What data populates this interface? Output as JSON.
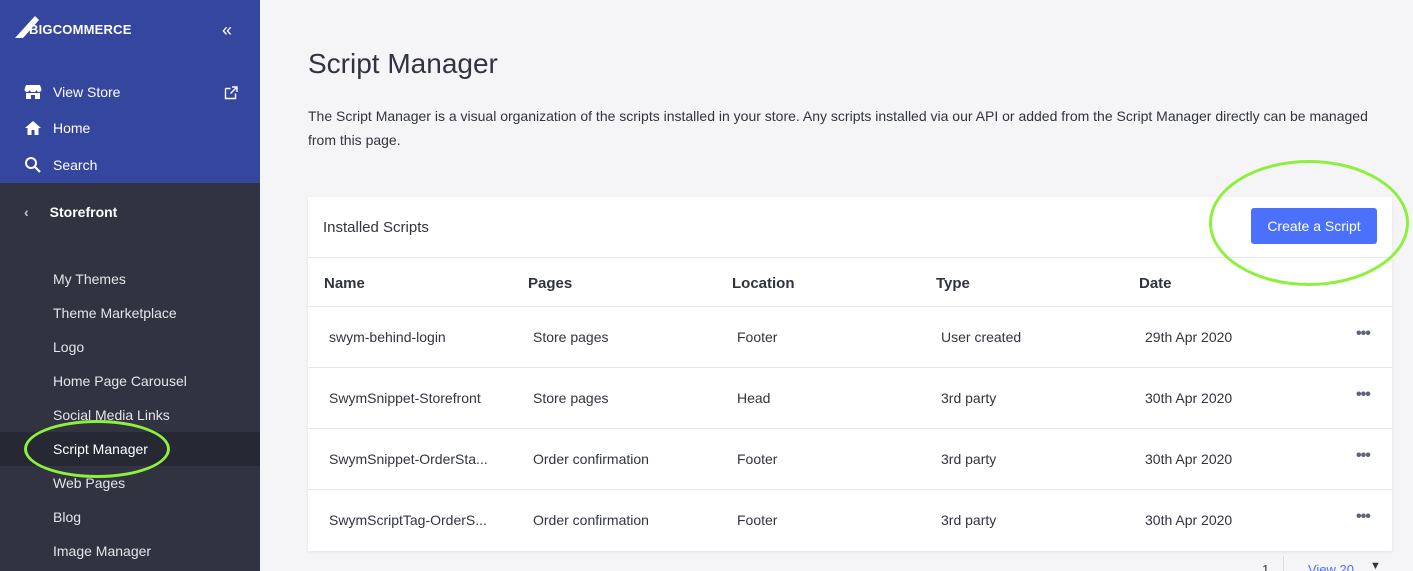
{
  "brand": {
    "logo_text": "BIGCOMMERCE",
    "collapse_glyph": "«"
  },
  "colors": {
    "sidebar_top": "#34469e",
    "sidebar": "#313440",
    "active_item": "#262833",
    "primary_button": "#4b71fc",
    "highlight_circle": "#8cf03c"
  },
  "top_nav": [
    {
      "label": "View Store",
      "icon": "store-icon"
    },
    {
      "label": "Home",
      "icon": "home-icon"
    },
    {
      "label": "Search",
      "icon": "search-icon"
    }
  ],
  "section": {
    "label": "Storefront",
    "chevron": "‹"
  },
  "sub_nav": [
    {
      "label": "My Themes"
    },
    {
      "label": "Theme Marketplace"
    },
    {
      "label": "Logo"
    },
    {
      "label": "Home Page Carousel"
    },
    {
      "label": "Social Media Links"
    },
    {
      "label": "Script Manager",
      "active": true
    },
    {
      "label": "Web Pages"
    },
    {
      "label": "Blog"
    },
    {
      "label": "Image Manager"
    }
  ],
  "page": {
    "title": "Script Manager",
    "description": "The Script Manager is a visual organization of the scripts installed in your store. Any scripts installed via our API or added from the Script Manager directly can be managed from this page."
  },
  "panel": {
    "title": "Installed Scripts",
    "create_button": "Create a Script",
    "columns": [
      "Name",
      "Pages",
      "Location",
      "Type",
      "Date"
    ],
    "rows": [
      {
        "name": "swym-behind-login",
        "pages": "Store pages",
        "location": "Footer",
        "type": "User created",
        "date": "29th Apr 2020",
        "menu": "•••"
      },
      {
        "name": "SwymSnippet-Storefront",
        "pages": "Store pages",
        "location": "Head",
        "type": "3rd party",
        "date": "30th Apr 2020",
        "menu": "•••"
      },
      {
        "name": "SwymSnippet-OrderSta...",
        "pages": "Order confirmation",
        "location": "Footer",
        "type": "3rd party",
        "date": "30th Apr 2020",
        "menu": "•••"
      },
      {
        "name": "SwymScriptTag-OrderS...",
        "pages": "Order confirmation",
        "location": "Footer",
        "type": "3rd party",
        "date": "30th Apr 2020",
        "menu": "•••"
      }
    ]
  },
  "pagination": {
    "page": "1",
    "view_label": "View 20",
    "caret": "▼"
  }
}
